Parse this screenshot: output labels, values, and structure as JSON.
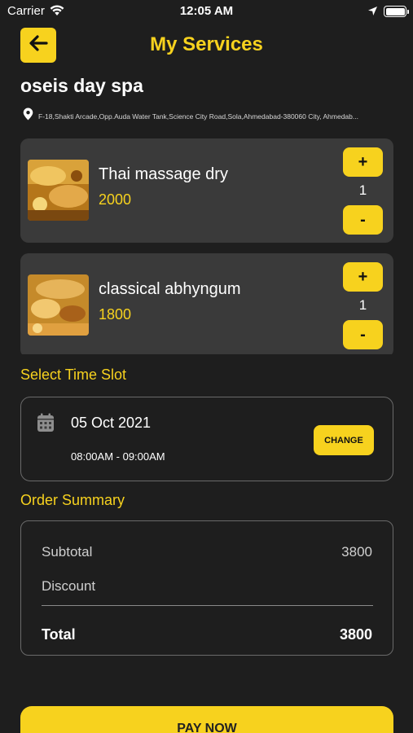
{
  "status_bar": {
    "carrier": "Carrier",
    "time": "12:05 AM",
    "wifi_icon": "wifi-icon",
    "location_icon": "location-arrow-icon",
    "battery_level": 1.0
  },
  "header": {
    "back_icon": "arrow-left-icon",
    "title": "My Services"
  },
  "shop": {
    "name": "oseis day spa",
    "address_icon": "map-pin-icon",
    "address": "F-18,Shakti Arcade,Opp.Auda Water Tank,Science City Road,Sola,Ahmedabad-380060 City, Ahmedab..."
  },
  "services": [
    {
      "name": "Thai massage dry",
      "price": "2000",
      "qty": "1",
      "plus": "+",
      "minus": "-"
    },
    {
      "name": "classical abhyngum",
      "price": "1800",
      "qty": "1",
      "plus": "+",
      "minus": "-"
    }
  ],
  "time_slot": {
    "heading": "Select Time Slot",
    "calendar_icon": "calendar-icon",
    "date": "05 Oct 2021",
    "time": "08:00AM - 09:00AM",
    "change_label": "CHANGE"
  },
  "summary": {
    "heading": "Order Summary",
    "subtotal_label": "Subtotal",
    "subtotal_value": "3800",
    "discount_label": "Discount",
    "discount_value": "",
    "total_label": "Total",
    "total_value": "3800"
  },
  "pay_button": {
    "label": "PAY NOW"
  },
  "colors": {
    "accent": "#f7d21e",
    "background": "#1e1e1e",
    "card": "#3a3a3a"
  }
}
